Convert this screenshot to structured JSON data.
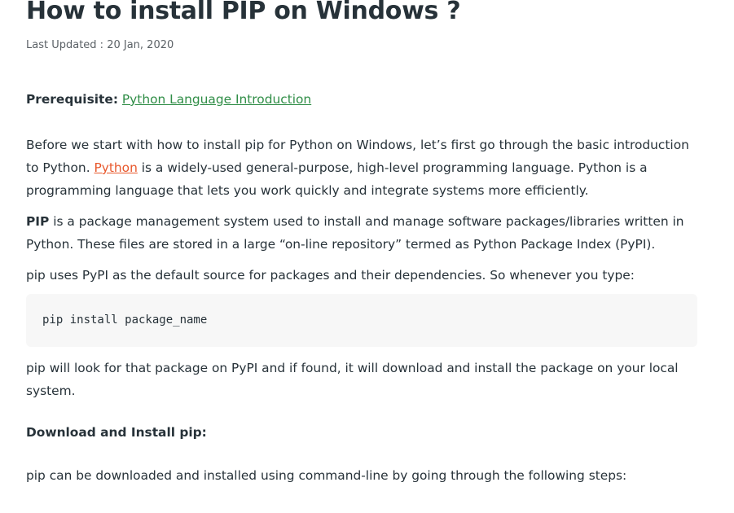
{
  "article": {
    "title": "How to install PIP on Windows ?",
    "last_updated": "Last Updated : 20 Jan, 2020",
    "prerequisite": {
      "label": "Prerequisite:",
      "link_text": "Python Language Introduction"
    },
    "intro": {
      "before_link": "Before we start with how to install pip for Python on Windows, let’s first go through the basic introduction to Python. ",
      "link_text": "Python",
      "after_link": " is a widely-used general-purpose, high-level programming language. Python is a programming language that lets you work quickly and integrate systems more efficiently."
    },
    "pip_desc": {
      "bold": "PIP",
      "rest": " is a package management system used to install and manage software packages/libraries written in Python. These files are stored in a large “on-line repository” termed as Python Package Index (PyPI)."
    },
    "uses_pypi": "pip uses PyPI as the default source for packages and their dependencies. So whenever you type:",
    "code": "pip install package_name",
    "look_for": "pip will look for that package on PyPI and if found, it will download and install the package on your local system.",
    "download_heading": "Download and Install pip:",
    "steps_intro": "pip can be downloaded and installed using command-line by going through the following steps:"
  },
  "colors": {
    "text": "#273239",
    "link_green": "#2f8d46",
    "link_orange": "#e8572b",
    "code_bg": "#f7f7f7"
  }
}
